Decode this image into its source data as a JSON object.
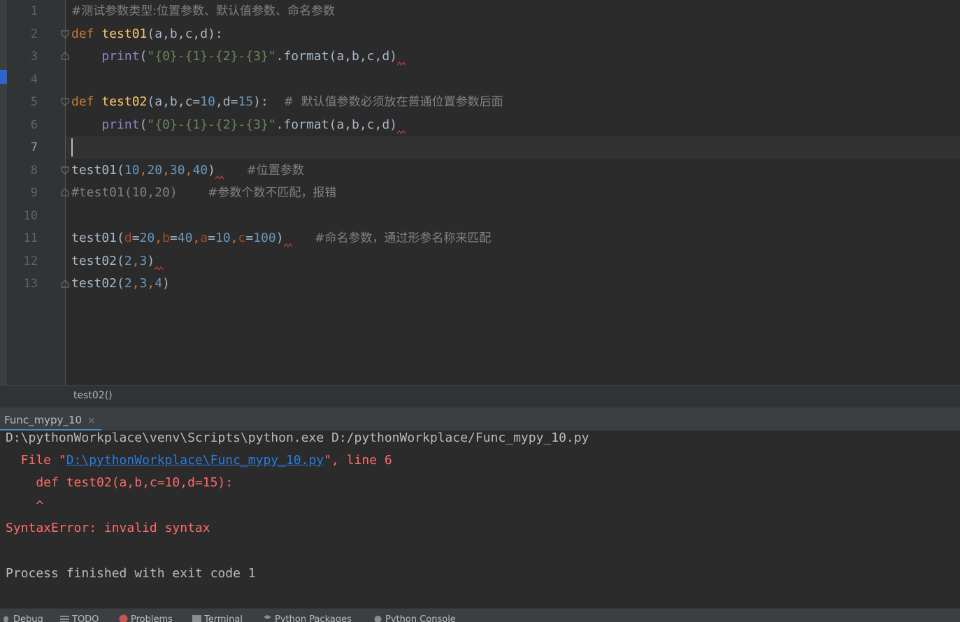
{
  "editor": {
    "line_numbers": [
      "1",
      "2",
      "3",
      "4",
      "5",
      "6",
      "7",
      "8",
      "9",
      "10",
      "11",
      "12",
      "13"
    ],
    "current_line": "7",
    "lines": {
      "l1": "#测试参数类型:位置参数、默认值参数、命名参数",
      "l2": {
        "kw": "def",
        "name": "test01",
        "params": "(a,b,c,d):"
      },
      "l3": {
        "fn": "print",
        "str": "\"{0}-{1}-{2}-{3}\"",
        "rest": ".format(a,b,c,d)"
      },
      "l5": {
        "kw": "def",
        "name": "test02",
        "p1": "(a,b,c=",
        "v1": "10",
        "p2": ",d=",
        "v2": "15",
        "p3": "):",
        "comment": "#  默认值参数必须放在普通位置参数后面"
      },
      "l6": {
        "fn": "print",
        "str": "\"{0}-{1}-{2}-{3}\"",
        "rest": ".format(a,b,c,d)"
      },
      "l8": {
        "call": "test01(",
        "args": [
          "10",
          "20",
          "30",
          "40"
        ],
        "close": ")",
        "comment": "#位置参数"
      },
      "l9": {
        "code": "#test01(10,20)",
        "comment": "#参数个数不匹配，报错"
      },
      "l11": {
        "call": "test01(",
        "k1": "d",
        "v1": "20",
        "k2": "b",
        "v2": "40",
        "k3": "a",
        "v3": "10",
        "k4": "c",
        "v4": "100",
        "close": ")",
        "comment": "#命名参数，通过形参名称来匹配"
      },
      "l12": {
        "call": "test02(",
        "a1": "2",
        "a2": "3",
        "close": ")"
      },
      "l13": {
        "call": "test02(",
        "a1": "2",
        "a2": "3",
        "a3": "4",
        "close": ")"
      }
    }
  },
  "breadcrumb": "test02()",
  "run_panel": {
    "tab_label": "Func_mypy_10",
    "close_glyph": "×"
  },
  "console": {
    "cmd": "D:\\pythonWorkplace\\venv\\Scripts\\python.exe D:/pythonWorkplace/Func_mypy_10.py",
    "file_prefix": "  File \"",
    "file_link": "D:\\pythonWorkplace\\Func_mypy_10.py",
    "file_suffix": "\", line 6",
    "err_code": "    def test02(a,b,c=10,d=15):",
    "caret": "    ^",
    "error": "SyntaxError: invalid syntax",
    "exit": "Process finished with exit code 1"
  },
  "tool_bar": {
    "debug": "Debug",
    "todo": "TODO",
    "problems": "Problems",
    "terminal": "Terminal",
    "packages": "Python Packages",
    "console": "Python Console"
  },
  "colors": {
    "editor_bg": "#2b2b2b",
    "keyword": "#cc7832",
    "function": "#ffc66d",
    "string": "#6a8759",
    "number": "#6897bb",
    "comment": "#808080",
    "error": "#ff6b68",
    "link": "#287bde"
  }
}
